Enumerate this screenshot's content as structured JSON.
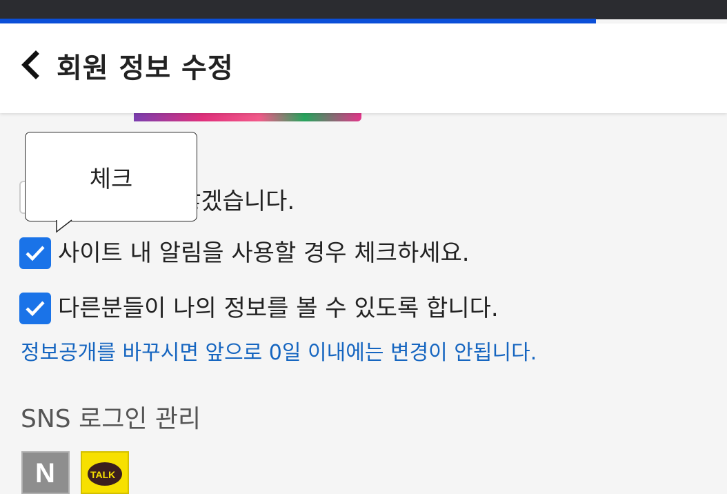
{
  "header": {
    "title": "회원 정보 수정"
  },
  "tooltip": {
    "text": "체크"
  },
  "settings": {
    "hidden_option_label": "않겠습니다.",
    "site_notifications_label": "사이트 내 알림을 사용할 경우 체크하세요.",
    "site_notifications_checked": true,
    "public_profile_label": "다른분들이 나의 정보를 볼 수 있도록 합니다.",
    "public_profile_checked": true,
    "public_profile_note": "정보공개를 바꾸시면 앞으로 0일 이내에는 변경이 안됩니다."
  },
  "sns": {
    "title": "SNS 로그인 관리",
    "naver_letter": "N",
    "kakao_letter": "TALK"
  },
  "colors": {
    "accent": "#1a73e8",
    "progress": "#0b4fd8",
    "info_text": "#1565c0",
    "naver": "#8e8e8e",
    "kakao": "#f7e000"
  }
}
